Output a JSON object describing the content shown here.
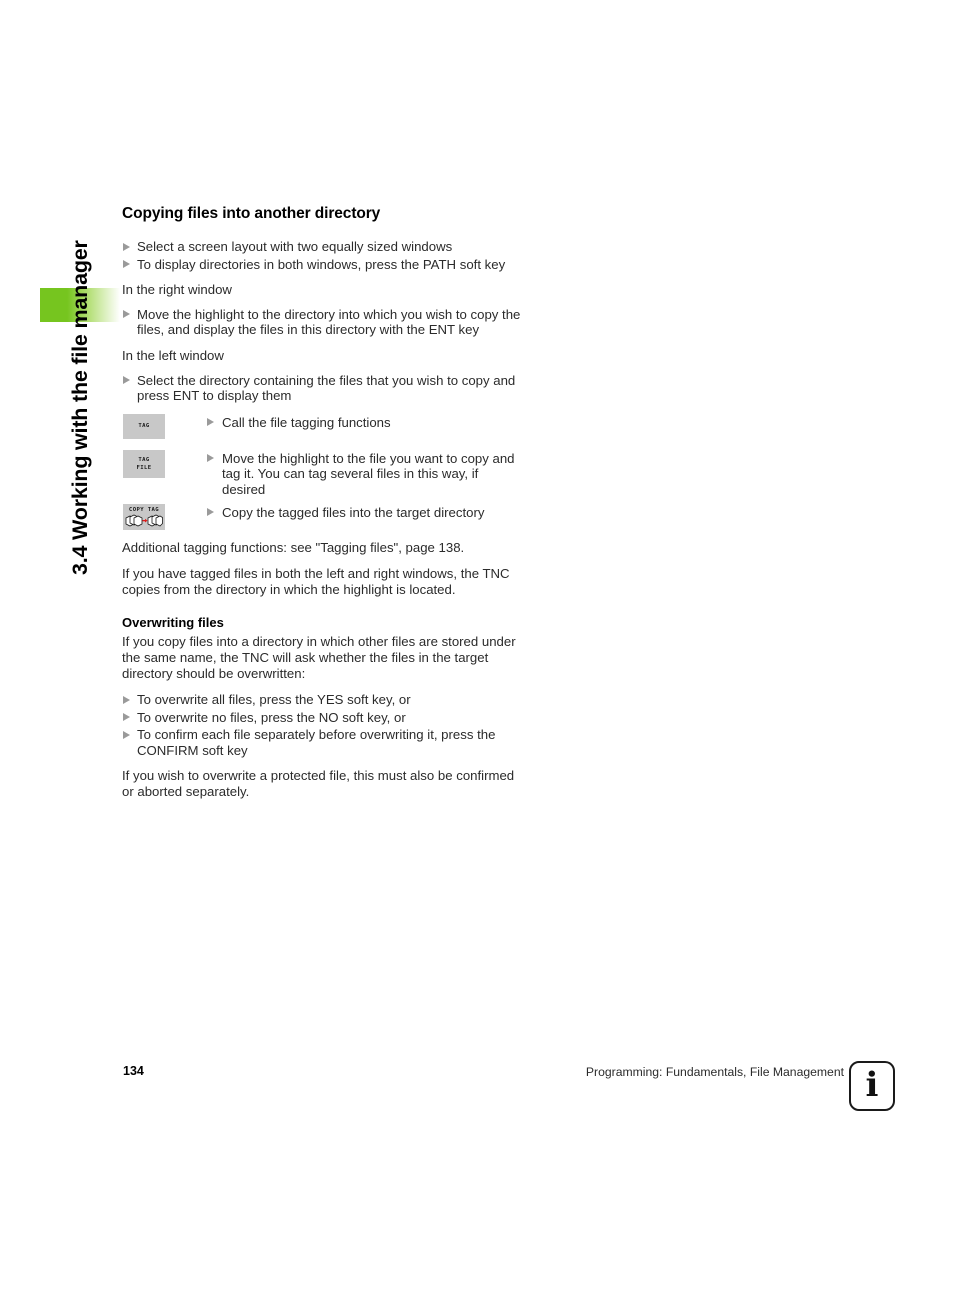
{
  "chapter": {
    "label": "3.4 Working with the file manager",
    "tab_color": "#76c51f"
  },
  "section": {
    "heading": "Copying files into another directory",
    "intro_bullets": [
      "Select a screen layout with two equally sized windows",
      "To display directories in both windows, press the PATH soft key"
    ],
    "right_window_label": "In the right window",
    "right_window_bullets": [
      "Move the highlight to the directory into which you wish to copy the files, and display the files in this directory with the ENT key"
    ],
    "left_window_label": "In the left window",
    "left_window_bullets": [
      "Select the directory containing the files that you wish to copy and press ENT to display them"
    ],
    "softkeys": [
      {
        "key_lines": [
          "TAG"
        ],
        "icon": "tag-softkey",
        "description": "Call the file tagging functions"
      },
      {
        "key_lines": [
          "TAG",
          "FILE"
        ],
        "icon": "tag-file-softkey",
        "description": "Move the highlight to the file you want to copy and tag it. You can tag several files in this way, if desired"
      },
      {
        "key_lines": [
          "COPY TAG"
        ],
        "icon": "copy-tag-softkey",
        "description": "Copy the tagged files into the target directory"
      }
    ],
    "note_reference": "Additional tagging functions: see \"Tagging files\", page 138.",
    "note_tagged": "If you have tagged files in both the left and right windows, the TNC copies from the directory in which the highlight is located."
  },
  "overwriting": {
    "heading": "Overwriting files",
    "intro": "If you copy files into a directory in which other files are stored under the same name, the TNC will ask whether the files in the target directory should be overwritten:",
    "bullets": [
      "To overwrite all files, press the YES soft key, or",
      "To overwrite no files, press the NO soft key, or",
      "To confirm each file separately before overwriting it, press the CONFIRM soft key"
    ],
    "closing": "If you wish to overwrite a protected file, this must also be confirmed or aborted separately."
  },
  "footer": {
    "page_number": "134",
    "text": "Programming: Fundamentals, File Management",
    "info_glyph": "i"
  }
}
